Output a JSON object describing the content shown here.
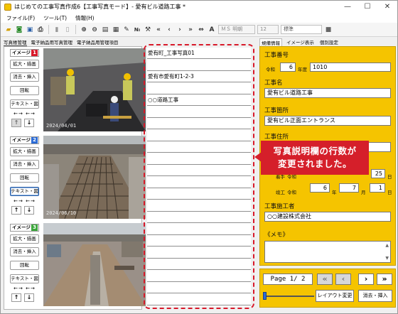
{
  "window": {
    "title": "はじめての工事写真作成6【工事写真モード】- 愛有ビル道路工事 *",
    "minimize": "—",
    "maximize": "☐",
    "close": "✕"
  },
  "menu": [
    "ファイル(F)",
    "ツール(T)",
    "情報(H)"
  ],
  "toolbar": {
    "no_label": "№",
    "font_name": "ＭＳ 明朝",
    "font_size": "12",
    "style": "標準"
  },
  "left_tabs": [
    "写真帳管理",
    "電子納品用写真管理",
    "電子納品用管理項目"
  ],
  "image_groups": [
    {
      "label": "イメージ",
      "number": "1",
      "badge_color": "#d8192a",
      "buttons": [
        "拡大・描画",
        "消去・挿入",
        "回転",
        "テキスト・図"
      ],
      "arrows": "←→ ←→",
      "up": "↑",
      "down": "↓",
      "date_stamp": "2024/04/01"
    },
    {
      "label": "イメージ",
      "number": "2",
      "badge_color": "#2a6ad5",
      "buttons": [
        "拡大・描画",
        "消去・挿入",
        "回転",
        "テキスト・図"
      ],
      "arrows": "←→ ←→",
      "up": "↑",
      "down": "↓",
      "date_stamp": "2024/06/10"
    },
    {
      "label": "イメージ",
      "number": "3",
      "badge_color": "#3aa63a",
      "buttons": [
        "拡大・描画",
        "消去・挿入",
        "回転",
        "テキスト・図"
      ],
      "arrows": "←→ ←→",
      "up": "↑",
      "down": "↓",
      "date_stamp": ""
    }
  ],
  "description_lines": [
    "愛有町_工事写真01",
    "",
    "愛有市愛有町1-2-3",
    "",
    "○○道路工事",
    "",
    "",
    "",
    "",
    "",
    "",
    "",
    "",
    "",
    "",
    "",
    "",
    "",
    "",
    "",
    "",
    ""
  ],
  "right_tabs": [
    "規備情報",
    "イメージ表示",
    "個別設定"
  ],
  "project": {
    "number_label": "工事番号",
    "era": "令和",
    "year": "6",
    "year_suffix": "年度",
    "number": "1010",
    "name_label": "工事名",
    "name": "愛有ビル道路工事",
    "place_label": "工事箇所",
    "place": "愛有ビル正面エントランス",
    "address_label": "工事住所",
    "start_label": "着手",
    "start_era": "令和",
    "start_day": "25",
    "end_label": "竣工",
    "end_era": "令和",
    "end_year": "6",
    "end_month": "7",
    "end_day": "1",
    "year_unit": "年",
    "month_unit": "月",
    "day_unit": "日",
    "contractor_label": "工事施工者",
    "contractor": "○○建設株式会社",
    "memo_label": "《メモ》"
  },
  "callout": {
    "line1": "写真説明欄の行数が",
    "line2": "変更されました。"
  },
  "navigation": {
    "page": "Page 1/ 2",
    "first": "«",
    "prev": "‹",
    "next": "›",
    "last": "»",
    "layout_button": "レイアウト変更",
    "remove_insert_button": "消去・挿入"
  },
  "colors": {
    "accent_yellow": "#f5c400",
    "callout_red": "#d51f2a",
    "dashed_red": "#d8192a"
  }
}
